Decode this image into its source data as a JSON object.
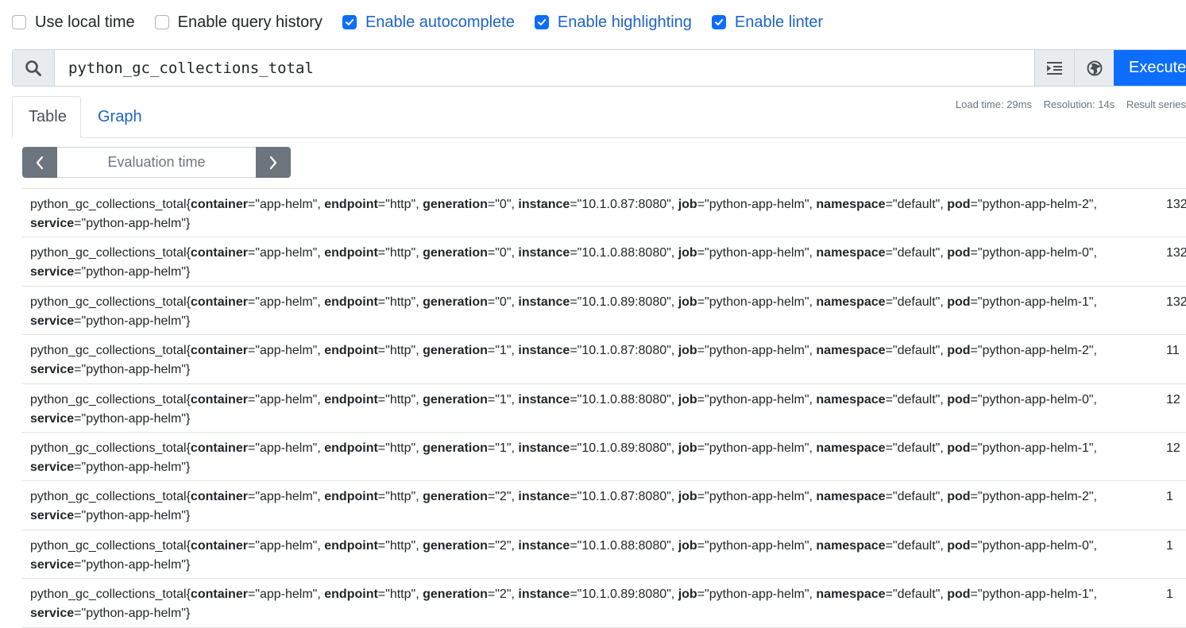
{
  "options": [
    {
      "label": "Use local time",
      "checked": false
    },
    {
      "label": "Enable query history",
      "checked": false
    },
    {
      "label": "Enable autocomplete",
      "checked": true
    },
    {
      "label": "Enable highlighting",
      "checked": true
    },
    {
      "label": "Enable linter",
      "checked": true
    }
  ],
  "expression": {
    "value": "python_gc_collections_total",
    "execute_label": "Execute"
  },
  "tabs": {
    "table": "Table",
    "graph": "Graph"
  },
  "stats": {
    "load_time": "Load time: 29ms",
    "resolution": "Resolution: 14s",
    "result_series": "Result series"
  },
  "eval_time": {
    "placeholder": "Evaluation time"
  },
  "colors": {
    "primary": "#0d6efd",
    "link": "#1d64c6",
    "secondary": "#6c757d"
  },
  "results": [
    {
      "metric": "python_gc_collections_total",
      "labels": [
        [
          "container",
          "app-helm"
        ],
        [
          "endpoint",
          "http"
        ],
        [
          "generation",
          "0"
        ],
        [
          "instance",
          "10.1.0.87:8080"
        ],
        [
          "job",
          "python-app-helm"
        ],
        [
          "namespace",
          "default"
        ],
        [
          "pod",
          "python-app-helm-2"
        ],
        [
          "service",
          "python-app-helm"
        ]
      ],
      "value": "132"
    },
    {
      "metric": "python_gc_collections_total",
      "labels": [
        [
          "container",
          "app-helm"
        ],
        [
          "endpoint",
          "http"
        ],
        [
          "generation",
          "0"
        ],
        [
          "instance",
          "10.1.0.88:8080"
        ],
        [
          "job",
          "python-app-helm"
        ],
        [
          "namespace",
          "default"
        ],
        [
          "pod",
          "python-app-helm-0"
        ],
        [
          "service",
          "python-app-helm"
        ]
      ],
      "value": "132"
    },
    {
      "metric": "python_gc_collections_total",
      "labels": [
        [
          "container",
          "app-helm"
        ],
        [
          "endpoint",
          "http"
        ],
        [
          "generation",
          "0"
        ],
        [
          "instance",
          "10.1.0.89:8080"
        ],
        [
          "job",
          "python-app-helm"
        ],
        [
          "namespace",
          "default"
        ],
        [
          "pod",
          "python-app-helm-1"
        ],
        [
          "service",
          "python-app-helm"
        ]
      ],
      "value": "132"
    },
    {
      "metric": "python_gc_collections_total",
      "labels": [
        [
          "container",
          "app-helm"
        ],
        [
          "endpoint",
          "http"
        ],
        [
          "generation",
          "1"
        ],
        [
          "instance",
          "10.1.0.87:8080"
        ],
        [
          "job",
          "python-app-helm"
        ],
        [
          "namespace",
          "default"
        ],
        [
          "pod",
          "python-app-helm-2"
        ],
        [
          "service",
          "python-app-helm"
        ]
      ],
      "value": "11"
    },
    {
      "metric": "python_gc_collections_total",
      "labels": [
        [
          "container",
          "app-helm"
        ],
        [
          "endpoint",
          "http"
        ],
        [
          "generation",
          "1"
        ],
        [
          "instance",
          "10.1.0.88:8080"
        ],
        [
          "job",
          "python-app-helm"
        ],
        [
          "namespace",
          "default"
        ],
        [
          "pod",
          "python-app-helm-0"
        ],
        [
          "service",
          "python-app-helm"
        ]
      ],
      "value": "12"
    },
    {
      "metric": "python_gc_collections_total",
      "labels": [
        [
          "container",
          "app-helm"
        ],
        [
          "endpoint",
          "http"
        ],
        [
          "generation",
          "1"
        ],
        [
          "instance",
          "10.1.0.89:8080"
        ],
        [
          "job",
          "python-app-helm"
        ],
        [
          "namespace",
          "default"
        ],
        [
          "pod",
          "python-app-helm-1"
        ],
        [
          "service",
          "python-app-helm"
        ]
      ],
      "value": "12"
    },
    {
      "metric": "python_gc_collections_total",
      "labels": [
        [
          "container",
          "app-helm"
        ],
        [
          "endpoint",
          "http"
        ],
        [
          "generation",
          "2"
        ],
        [
          "instance",
          "10.1.0.87:8080"
        ],
        [
          "job",
          "python-app-helm"
        ],
        [
          "namespace",
          "default"
        ],
        [
          "pod",
          "python-app-helm-2"
        ],
        [
          "service",
          "python-app-helm"
        ]
      ],
      "value": "1"
    },
    {
      "metric": "python_gc_collections_total",
      "labels": [
        [
          "container",
          "app-helm"
        ],
        [
          "endpoint",
          "http"
        ],
        [
          "generation",
          "2"
        ],
        [
          "instance",
          "10.1.0.88:8080"
        ],
        [
          "job",
          "python-app-helm"
        ],
        [
          "namespace",
          "default"
        ],
        [
          "pod",
          "python-app-helm-0"
        ],
        [
          "service",
          "python-app-helm"
        ]
      ],
      "value": "1"
    },
    {
      "metric": "python_gc_collections_total",
      "labels": [
        [
          "container",
          "app-helm"
        ],
        [
          "endpoint",
          "http"
        ],
        [
          "generation",
          "2"
        ],
        [
          "instance",
          "10.1.0.89:8080"
        ],
        [
          "job",
          "python-app-helm"
        ],
        [
          "namespace",
          "default"
        ],
        [
          "pod",
          "python-app-helm-1"
        ],
        [
          "service",
          "python-app-helm"
        ]
      ],
      "value": "1"
    }
  ]
}
